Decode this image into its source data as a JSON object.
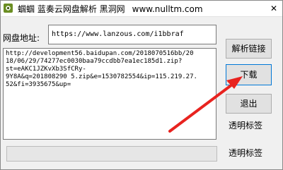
{
  "window": {
    "title": "蝈蝈 蓝奏云网盘解析 黑洞网",
    "title_url": "www.nulltm.com",
    "close_glyph": "✕"
  },
  "address": {
    "label": "网盘地址:",
    "value": "https://www.lanzous.com/i1bbraf"
  },
  "result": {
    "text": "http://development56.baidupan.com/2018070516bb/20\n18/06/29/74277ec0030baa79ccdbb7ea1ec185d1.zip?\nst=eAKC1JZKvXb3SfCRy-\n9Y8A&q=201808290 5.zip&e=1530782554&ip=115.219.27.\n52&fi=3935675&up="
  },
  "buttons": {
    "parse": "解析链接",
    "download": "下载",
    "exit": "退出"
  },
  "labels": {
    "status_1": "透明标签",
    "status_2": "透明标签"
  },
  "progress": {
    "value": 0
  },
  "annotation": {
    "arrow_color": "#e8231f"
  }
}
